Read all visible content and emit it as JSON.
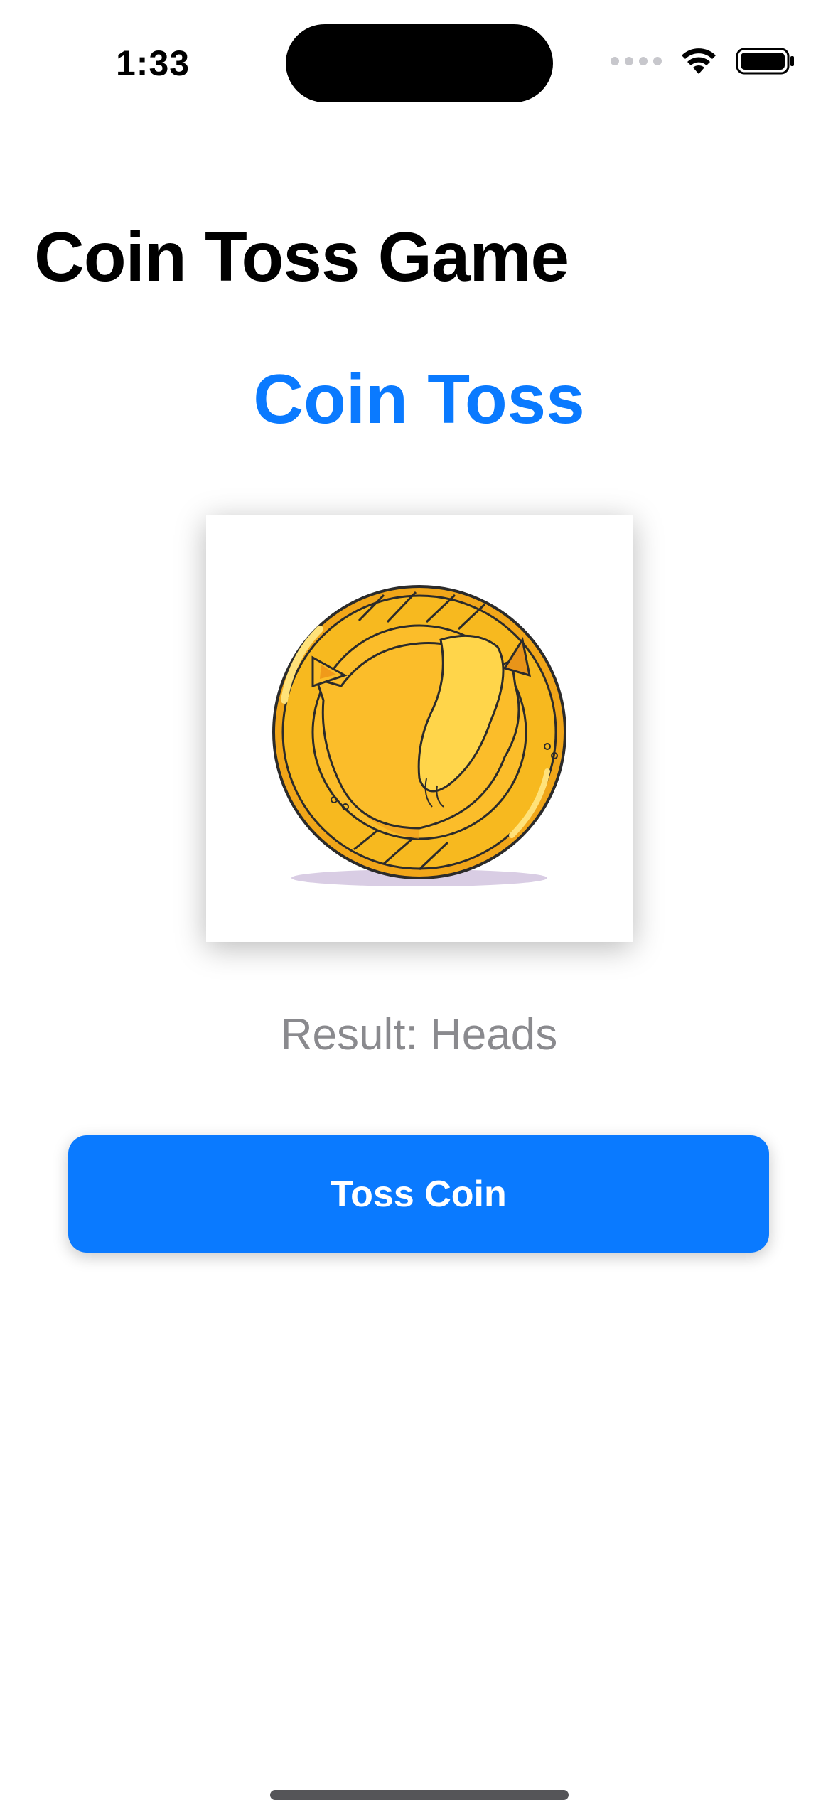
{
  "status_bar": {
    "time": "1:33",
    "icons": [
      "cellular-signal-icon",
      "wifi-icon",
      "battery-icon"
    ]
  },
  "nav": {
    "title": "Coin Toss Game"
  },
  "main": {
    "title": "Coin Toss",
    "coin_image": "coin-heads-cat-icon",
    "result": "Result: Heads",
    "button_label": "Toss Coin"
  },
  "colors": {
    "accent": "#0a7aff",
    "result_text": "#8a8a8e",
    "coin_gold": "#f7b91f"
  }
}
